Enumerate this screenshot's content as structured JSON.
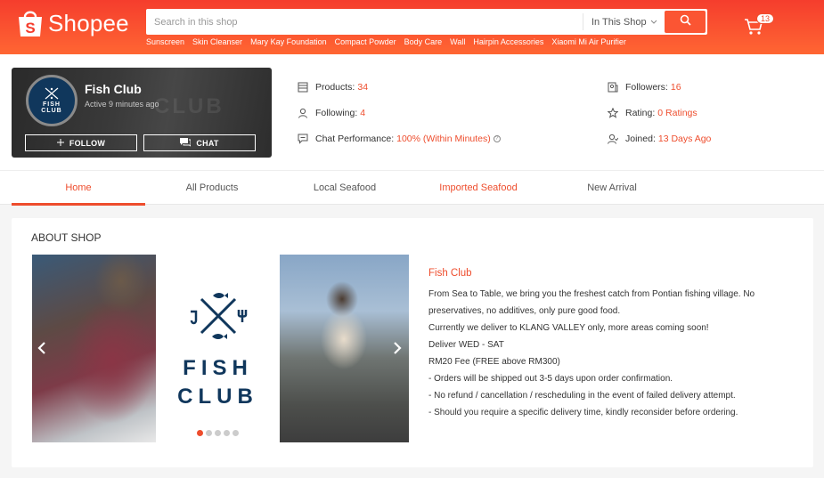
{
  "header": {
    "brand": "Shopee",
    "search_placeholder": "Search in this shop",
    "search_scope": "In This Shop",
    "suggestions": [
      "Sunscreen",
      "Skin Cleanser",
      "Mary Kay Foundation",
      "Compact Powder",
      "Body Care",
      "Wall",
      "Hairpin Accessories",
      "Xiaomi Mi Air Purifier"
    ],
    "cart_count": "13"
  },
  "shop": {
    "name": "Fish Club",
    "active": "Active 9 minutes ago",
    "avatar_line1": "FISH",
    "avatar_line2": "CLUB",
    "follow_label": "FOLLOW",
    "chat_label": "CHAT",
    "bg_text": "CLUB"
  },
  "stats": {
    "products_label": "Products:",
    "products_value": "34",
    "following_label": "Following:",
    "following_value": "4",
    "chat_label": "Chat Performance:",
    "chat_value": "100% (Within Minutes)",
    "followers_label": "Followers:",
    "followers_value": "16",
    "rating_label": "Rating:",
    "rating_value": "0 Ratings",
    "joined_label": "Joined:",
    "joined_value": "13 Days Ago"
  },
  "tabs": [
    "Home",
    "All Products",
    "Local Seafood",
    "Imported Seafood",
    "New Arrival"
  ],
  "about": {
    "title": "ABOUT SHOP",
    "logo_line1": "FISH",
    "logo_line2": "CLUB",
    "desc_title": "Fish Club",
    "desc_lines": [
      "From Sea to Table, we bring you the freshest catch from Pontian fishing village. No",
      "preservatives, no additives, only pure good food.",
      "Currently we deliver to KLANG VALLEY only, more areas coming soon!",
      "Deliver WED - SAT",
      "RM20 Fee (FREE above RM300)",
      "- Orders will be shipped out 3-5 days upon order confirmation.",
      "- No refund / cancellation / rescheduling in the event of failed delivery attempt.",
      "- Should you require a specific delivery time, kindly reconsider before ordering."
    ],
    "slide_count": 5,
    "active_slide": 1
  },
  "colors": {
    "brand": "#ee4d2d",
    "avatar_bg": "#10375c"
  }
}
